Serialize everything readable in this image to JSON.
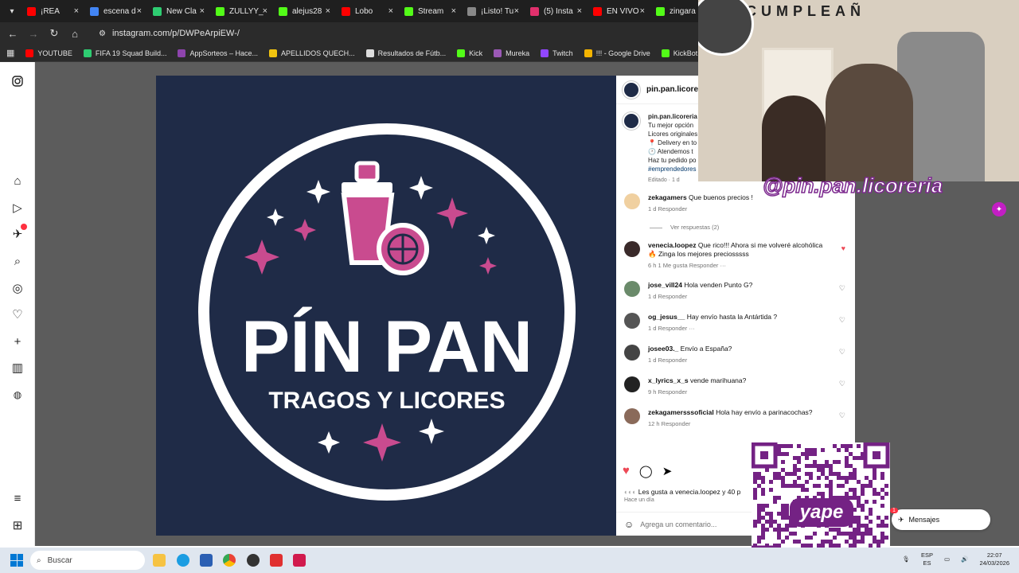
{
  "tabs": [
    {
      "label": "¡REA",
      "color": "#ff0000"
    },
    {
      "label": "escena d",
      "color": "#4285f4"
    },
    {
      "label": "New Cla",
      "color": "#2ecc71"
    },
    {
      "label": "ZULLYY_",
      "color": "#53fc18"
    },
    {
      "label": "alejus28",
      "color": "#53fc18"
    },
    {
      "label": "Lobo",
      "color": "#ff0000"
    },
    {
      "label": "Stream",
      "color": "#53fc18"
    },
    {
      "label": "¡Listo! Tu",
      "color": "#888888"
    },
    {
      "label": "(5) Insta",
      "color": "#e1306c"
    },
    {
      "label": "EN VIVO",
      "color": "#ff0000"
    },
    {
      "label": "zingara",
      "color": "#53fc18"
    }
  ],
  "address": {
    "url": "instagram.com/p/DWPeArpiEW-/"
  },
  "bookmarks": [
    {
      "label": "YOUTUBE",
      "color": "#ff0000"
    },
    {
      "label": "FIFA 19 Squad Build...",
      "color": "#2ecc71"
    },
    {
      "label": "AppSorteos – Hace...",
      "color": "#8e44ad"
    },
    {
      "label": "APELLIDOS QUECH...",
      "color": "#f1c40f"
    },
    {
      "label": "Resultados de Fútb...",
      "color": "#dddddd"
    },
    {
      "label": "Kick",
      "color": "#53fc18"
    },
    {
      "label": "Mureka",
      "color": "#9b59b6"
    },
    {
      "label": "Twitch",
      "color": "#9146ff"
    },
    {
      "label": "!!! - Google Drive",
      "color": "#f4b400"
    },
    {
      "label": "KickBot: Customiza...",
      "color": "#53fc18"
    },
    {
      "label": "EA FC",
      "color": "#dddddd"
    }
  ],
  "post": {
    "brand_line1": "PÍN PAN",
    "brand_line2": "TRAGOS Y LICORES"
  },
  "panel": {
    "username": "pin.pan.licoreria",
    "caption_user": "pin.pan.licoreria",
    "caption_lines": [
      "Tu mejor opción",
      "Licores originales",
      "📍 Delivery en to",
      "🕐 Atendemos t",
      "Haz tu pedido po",
      "#emprendedores"
    ],
    "caption_meta": "Editado · 1 d",
    "view_replies": "Ver respuestas (2)",
    "comments": [
      {
        "user": "zekagamers",
        "text": "Que buenos precios !",
        "meta": "1 d    Responder",
        "liked": false
      },
      {
        "user": "venecia.loopez",
        "text": "Que rico!!! Ahora si me volveré alcohólica 🔥 Zinga los mejores preciosssss",
        "meta": "6 h    1 Me gusta    Responder    ···",
        "liked": true
      },
      {
        "user": "jose_vill24",
        "text": "Hola venden Punto G?",
        "meta": "1 d    Responder",
        "liked": false
      },
      {
        "user": "og_jesus__",
        "text": "Hay envío hasta la Antártida ?",
        "meta": "1 d    Responder    ···",
        "liked": false
      },
      {
        "user": "josee03._",
        "text": "Envío a España?",
        "meta": "1 d    Responder",
        "liked": false
      },
      {
        "user": "x_lyrics_x_s",
        "text": "vende marihuana?",
        "meta": "9 h    Responder",
        "liked": false
      },
      {
        "user": "zekagamersssoficial",
        "text": "Hola hay envío a parinacochas?",
        "meta": "12 h    Responder",
        "liked": false
      }
    ],
    "likes_text": "Les gusta a venecia.loopez y 40 p",
    "time_text": "Hace un día",
    "add_comment_placeholder": "Agrega un comentario..."
  },
  "stream_overlay": {
    "tag": "@pin.pan.licoreria",
    "banner": "CUMPLEAÑ",
    "qr_brand": "yape"
  },
  "messages": {
    "label": "Mensajes",
    "badge": "1"
  },
  "taskbar": {
    "search_placeholder": "Buscar",
    "lang": "ESP",
    "lang2": "ES",
    "time": "22:07",
    "date": "24/03/2026"
  },
  "colors": {
    "accent": "#7d2a8f",
    "brand_navy": "#1f2b47",
    "brand_pink": "#c94b8f",
    "like_red": "#ed4956"
  }
}
